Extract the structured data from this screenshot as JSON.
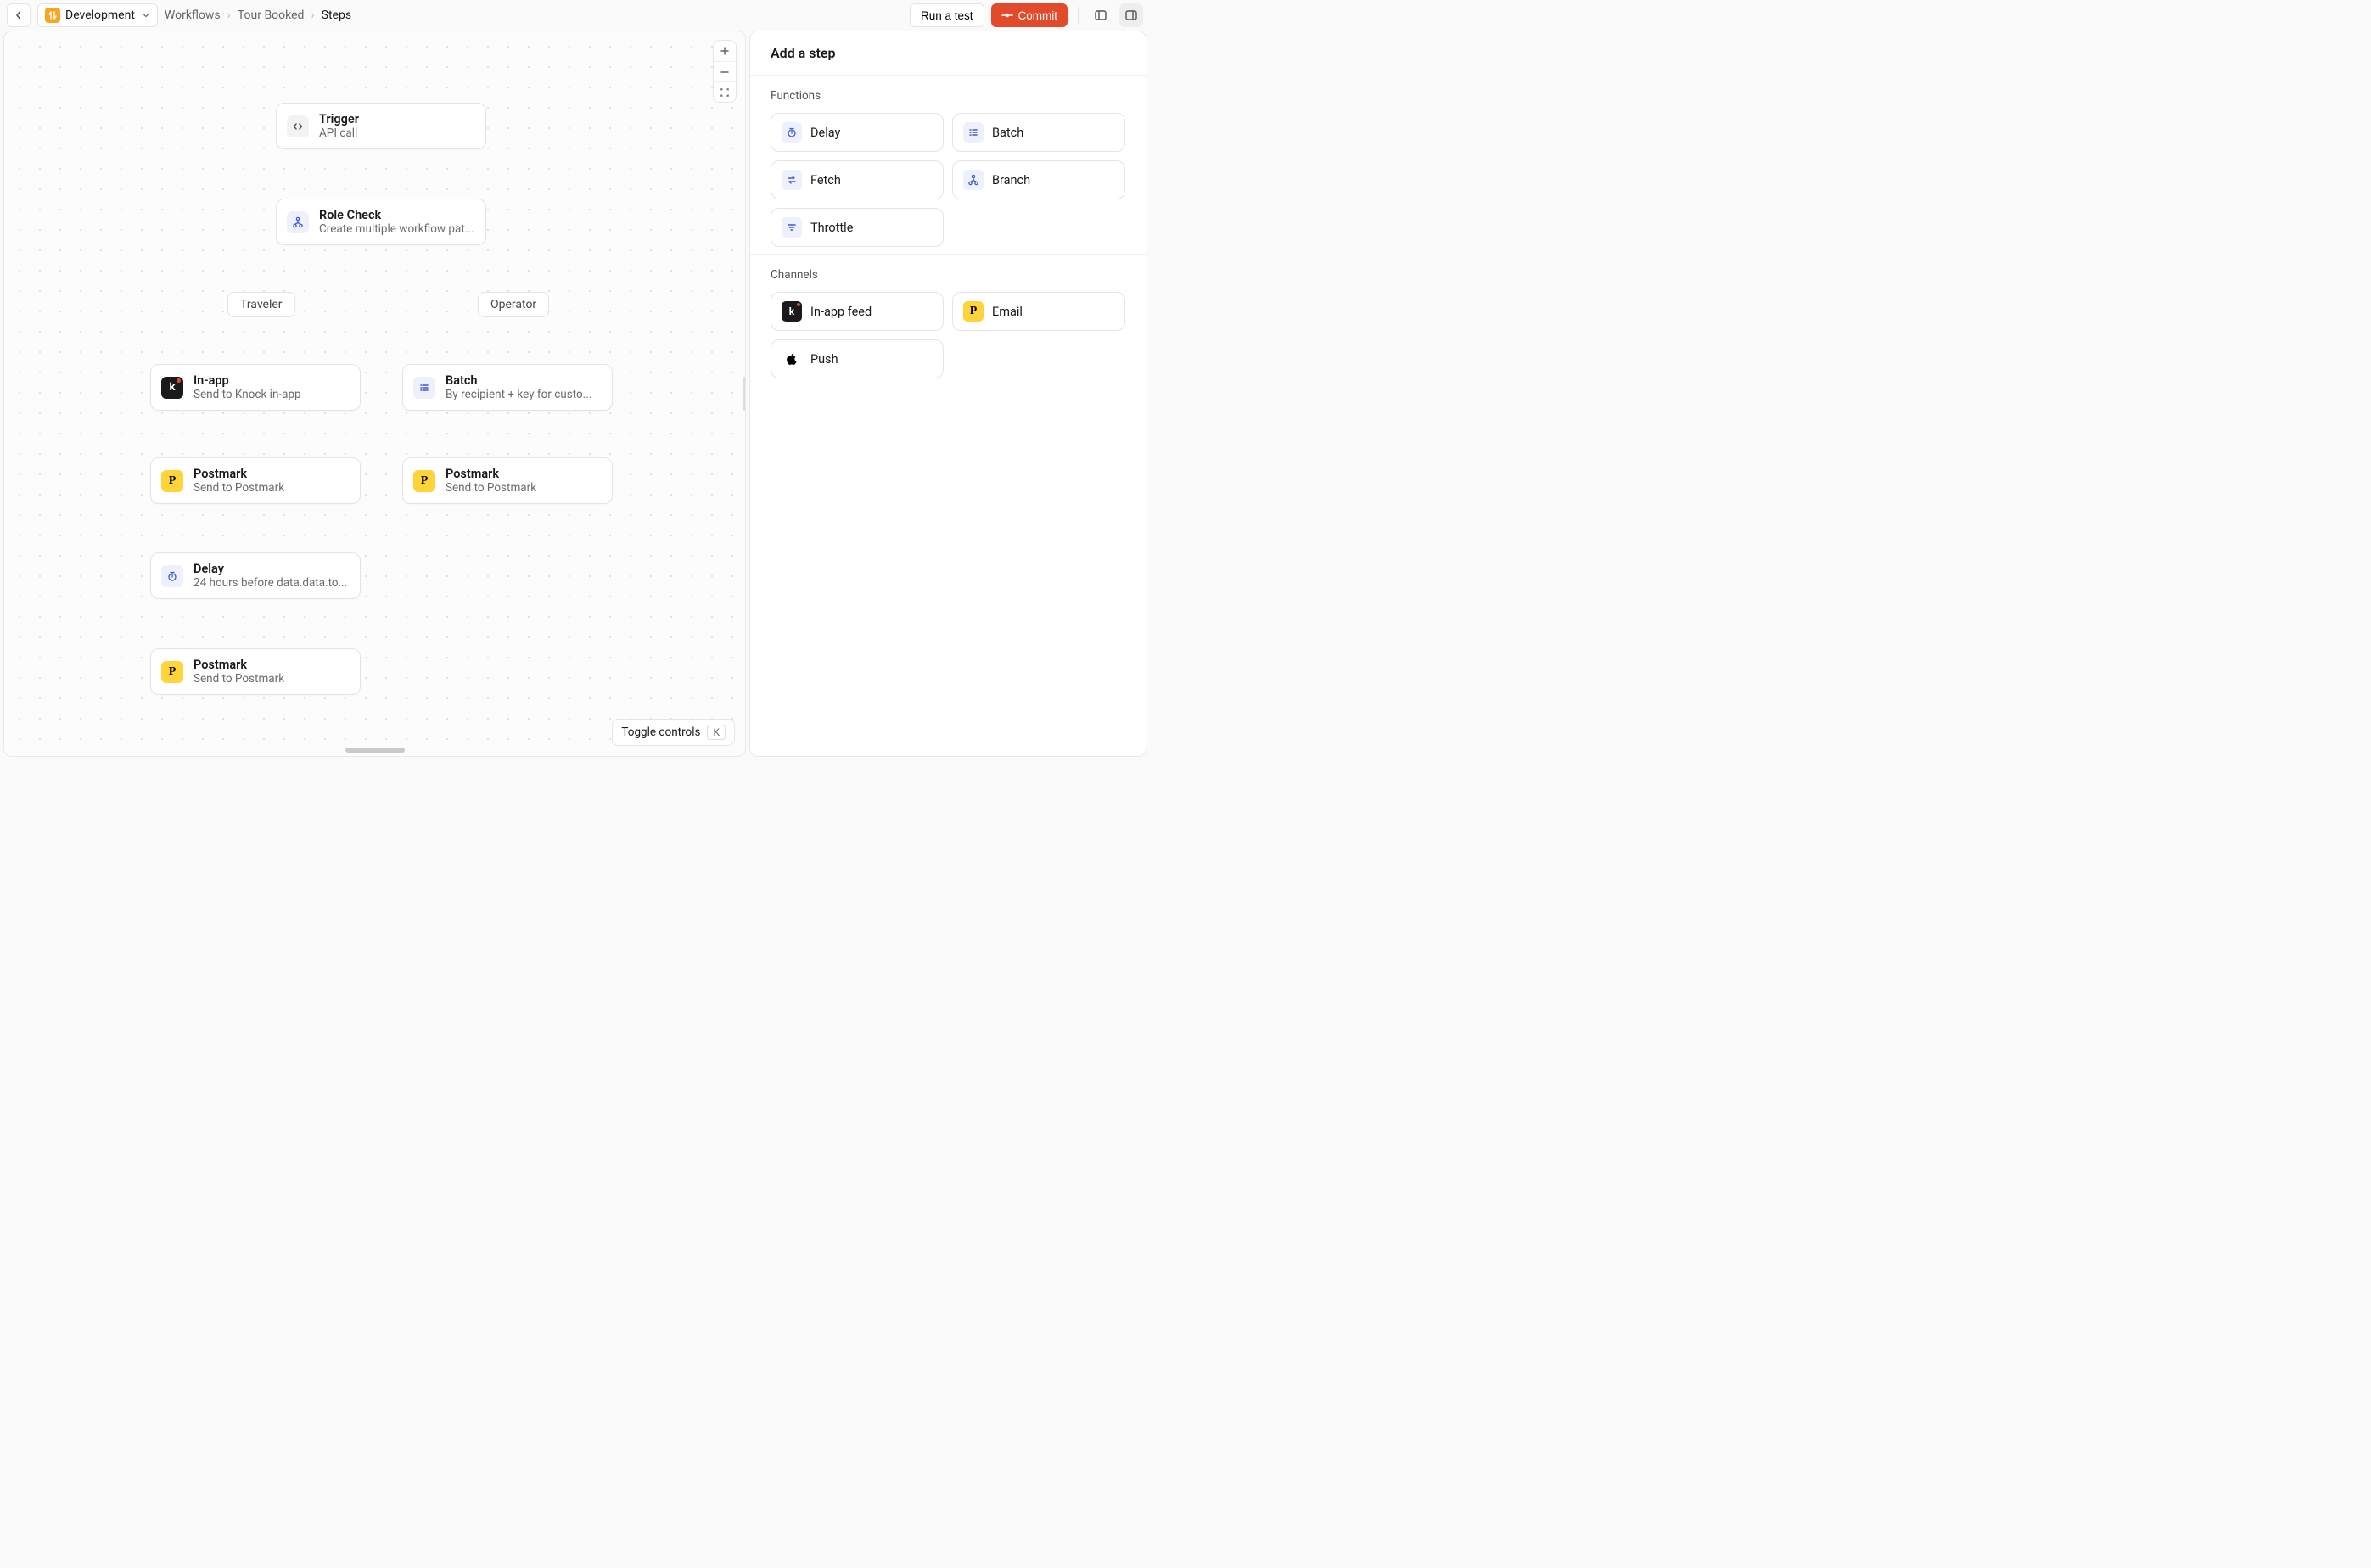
{
  "header": {
    "env_label": "Development",
    "breadcrumbs": [
      "Workflows",
      "Tour Booked",
      "Steps"
    ],
    "run_test_label": "Run a test",
    "commit_label": "Commit"
  },
  "canvas": {
    "toggle_label": "Toggle controls",
    "toggle_key": "K",
    "branches": {
      "left_label": "Traveler",
      "right_label": "Operator"
    },
    "nodes": {
      "trigger": {
        "title": "Trigger",
        "sub": "API call"
      },
      "role_check": {
        "title": "Role Check",
        "sub": "Create multiple workflow pat..."
      },
      "inapp": {
        "title": "In-app",
        "sub": "Send to Knock in-app"
      },
      "batch": {
        "title": "Batch",
        "sub": "By recipient + key for custo..."
      },
      "postmark_l1": {
        "title": "Postmark",
        "sub": "Send to Postmark"
      },
      "postmark_r1": {
        "title": "Postmark",
        "sub": "Send to Postmark"
      },
      "delay": {
        "title": "Delay",
        "sub": "24 hours before data.data.to..."
      },
      "postmark_l2": {
        "title": "Postmark",
        "sub": "Send to Postmark"
      }
    }
  },
  "sidebar": {
    "title": "Add a step",
    "functions_label": "Functions",
    "channels_label": "Channels",
    "functions": [
      {
        "key": "delay",
        "label": "Delay"
      },
      {
        "key": "batch",
        "label": "Batch"
      },
      {
        "key": "fetch",
        "label": "Fetch"
      },
      {
        "key": "branch",
        "label": "Branch"
      },
      {
        "key": "throttle",
        "label": "Throttle"
      }
    ],
    "channels": [
      {
        "key": "inapp",
        "label": "In-app feed"
      },
      {
        "key": "email",
        "label": "Email"
      },
      {
        "key": "push",
        "label": "Push"
      }
    ]
  }
}
